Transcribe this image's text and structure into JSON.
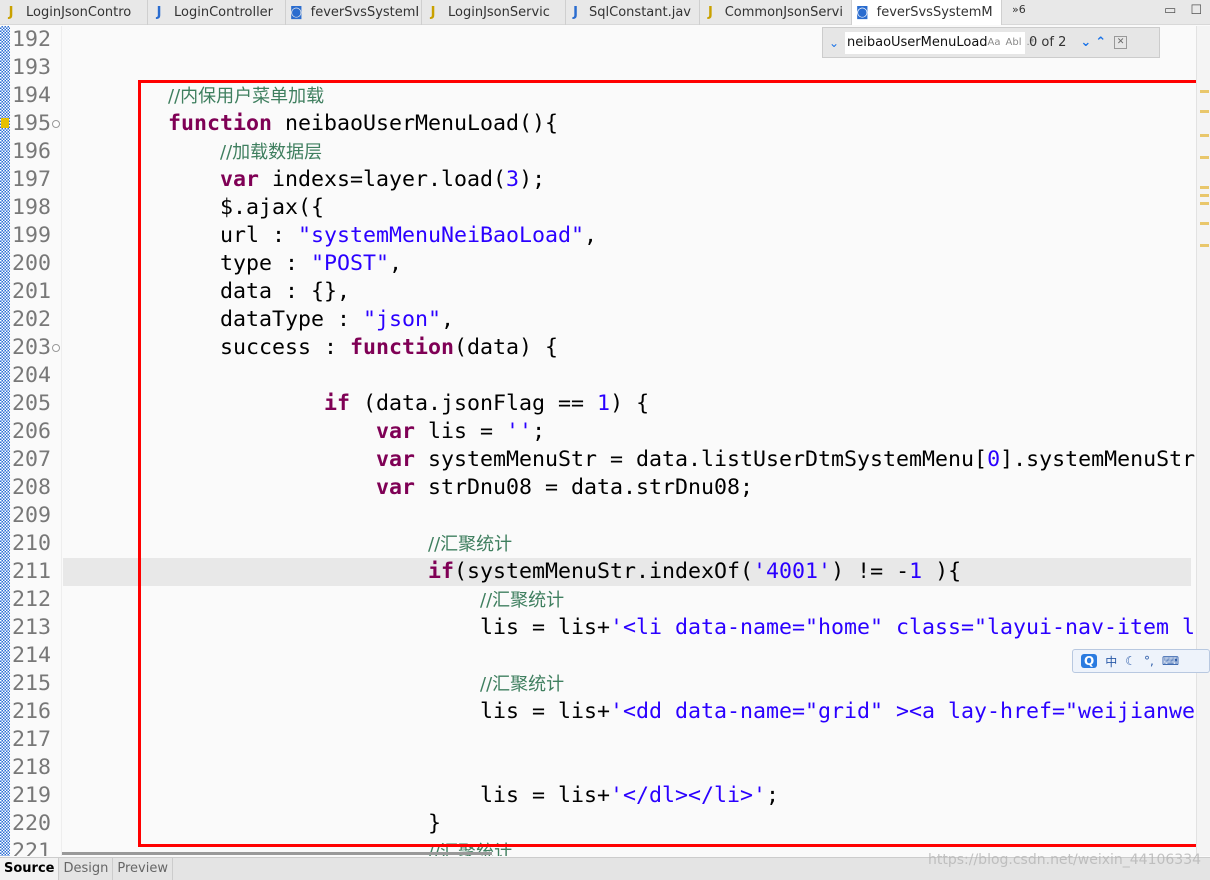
{
  "tabs": [
    {
      "label": "LoginJsonContro",
      "icon": "java-warning-icon"
    },
    {
      "label": "LoginController",
      "icon": "java-icon"
    },
    {
      "label": "feverSvsSystemI",
      "icon": "jsp-icon"
    },
    {
      "label": "LoginJsonServic",
      "icon": "java-warning-icon"
    },
    {
      "label": "SqlConstant.jav",
      "icon": "java-icon"
    },
    {
      "label": "CommonJsonServi",
      "icon": "java-warning-icon"
    },
    {
      "label": "feverSvsSystemM",
      "icon": "jsp-icon",
      "active": true
    }
  ],
  "overflow_tabs": "»6",
  "find": {
    "query": "neibaoUserMenuLoad",
    "match_case": "Aa",
    "whole_word": "Abl",
    "regex": ".*",
    "count": "0 of 2"
  },
  "code": [
    {
      "n": "192",
      "t": []
    },
    {
      "n": "193",
      "t": []
    },
    {
      "n": "194",
      "t": [
        [
          "p",
          "        "
        ],
        [
          "c",
          "//内保用户菜单加载"
        ]
      ]
    },
    {
      "n": "195",
      "t": [
        [
          "p",
          "        "
        ],
        [
          "k",
          "function"
        ],
        [
          "p",
          " neibaoUserMenuLoad(){"
        ]
      ],
      "fold": true,
      "mark": true
    },
    {
      "n": "196",
      "t": [
        [
          "p",
          "            "
        ],
        [
          "c",
          "//加载数据层"
        ]
      ]
    },
    {
      "n": "197",
      "t": [
        [
          "p",
          "            "
        ],
        [
          "k",
          "var"
        ],
        [
          "p",
          " indexs=layer.load("
        ],
        [
          "n",
          "3"
        ],
        [
          "p",
          ");"
        ]
      ]
    },
    {
      "n": "198",
      "t": [
        [
          "p",
          "            $.ajax({"
        ]
      ]
    },
    {
      "n": "199",
      "t": [
        [
          "p",
          "            url : "
        ],
        [
          "s",
          "\"systemMenuNeiBaoLoad\""
        ],
        [
          "p",
          ","
        ]
      ]
    },
    {
      "n": "200",
      "t": [
        [
          "p",
          "            type : "
        ],
        [
          "s",
          "\"POST\""
        ],
        [
          "p",
          ","
        ]
      ]
    },
    {
      "n": "201",
      "t": [
        [
          "p",
          "            data : {},"
        ]
      ]
    },
    {
      "n": "202",
      "t": [
        [
          "p",
          "            dataType : "
        ],
        [
          "s",
          "\"json\""
        ],
        [
          "p",
          ","
        ]
      ]
    },
    {
      "n": "203",
      "t": [
        [
          "p",
          "            success : "
        ],
        [
          "k",
          "function"
        ],
        [
          "p",
          "(data) {"
        ]
      ],
      "fold": true
    },
    {
      "n": "204",
      "t": []
    },
    {
      "n": "205",
      "t": [
        [
          "p",
          "                    "
        ],
        [
          "k",
          "if"
        ],
        [
          "p",
          " (data.jsonFlag == "
        ],
        [
          "n",
          "1"
        ],
        [
          "p",
          ") {"
        ]
      ]
    },
    {
      "n": "206",
      "t": [
        [
          "p",
          "                        "
        ],
        [
          "k",
          "var"
        ],
        [
          "p",
          " lis = "
        ],
        [
          "s",
          "''"
        ],
        [
          "p",
          ";"
        ]
      ]
    },
    {
      "n": "207",
      "t": [
        [
          "p",
          "                        "
        ],
        [
          "k",
          "var"
        ],
        [
          "p",
          " systemMenuStr = data.listUserDtmSystemMenu["
        ],
        [
          "n",
          "0"
        ],
        [
          "p",
          "].systemMenuStr"
        ]
      ]
    },
    {
      "n": "208",
      "t": [
        [
          "p",
          "                        "
        ],
        [
          "k",
          "var"
        ],
        [
          "p",
          " strDnu08 = data.strDnu08;"
        ]
      ]
    },
    {
      "n": "209",
      "t": []
    },
    {
      "n": "210",
      "t": [
        [
          "p",
          "                            "
        ],
        [
          "c",
          "//汇聚统计"
        ]
      ]
    },
    {
      "n": "211",
      "t": [
        [
          "p",
          "                            "
        ],
        [
          "k",
          "if"
        ],
        [
          "p",
          "(systemMenuStr.indexOf("
        ],
        [
          "s",
          "'4001'"
        ],
        [
          "p",
          ") != -"
        ],
        [
          "n",
          "1"
        ],
        [
          "p",
          " ){"
        ]
      ],
      "current": true
    },
    {
      "n": "212",
      "t": [
        [
          "p",
          "                                "
        ],
        [
          "c",
          "//汇聚统计"
        ]
      ]
    },
    {
      "n": "213",
      "t": [
        [
          "p",
          "                                lis = lis+"
        ],
        [
          "s",
          "'<li data-name=\"home\" class=\"layui-nav-item l"
        ]
      ]
    },
    {
      "n": "214",
      "t": []
    },
    {
      "n": "215",
      "t": [
        [
          "p",
          "                                "
        ],
        [
          "c",
          "//汇聚统计"
        ]
      ]
    },
    {
      "n": "216",
      "t": [
        [
          "p",
          "                                lis = lis+"
        ],
        [
          "s",
          "'<dd data-name=\"grid\" ><a lay-href=\"weijianwe"
        ]
      ]
    },
    {
      "n": "217",
      "t": []
    },
    {
      "n": "218",
      "t": []
    },
    {
      "n": "219",
      "t": [
        [
          "p",
          "                                lis = lis+"
        ],
        [
          "s",
          "'</dl></li>'"
        ],
        [
          "p",
          ";"
        ]
      ]
    },
    {
      "n": "220",
      "t": [
        [
          "p",
          "                            }"
        ]
      ]
    },
    {
      "n": "221",
      "t": [
        [
          "p",
          "                            "
        ],
        [
          "c",
          "//汇聚统计"
        ]
      ]
    }
  ],
  "bottom_tabs": [
    "Source",
    "Design",
    "Preview"
  ],
  "ime": {
    "logo": "Q",
    "mode": "中"
  },
  "watermark": "https://blog.csdn.net/weixin_44106334",
  "colors": {
    "keyword": "#7f0055",
    "comment": "#3f7f5f",
    "string": "#2a00ff",
    "highlight_box": "#ff0000"
  }
}
